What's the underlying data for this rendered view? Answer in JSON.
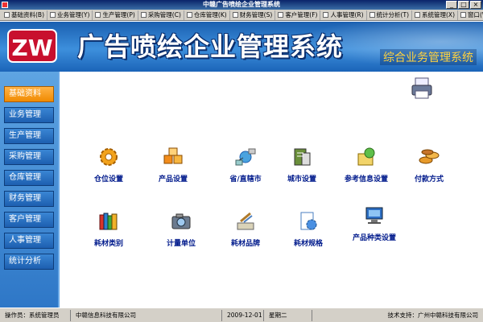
{
  "window": {
    "title": "中赣广告喷绘企业管理系统",
    "controls": [
      "_",
      "□",
      "×"
    ]
  },
  "menu": [
    {
      "label": "基础资料(B)"
    },
    {
      "label": "业务管理(Y)"
    },
    {
      "label": "生产管理(P)"
    },
    {
      "label": "采购管理(C)"
    },
    {
      "label": "仓库管理(K)"
    },
    {
      "label": "财务管理(S)"
    },
    {
      "label": "客户管理(F)"
    },
    {
      "label": "人事管理(R)"
    },
    {
      "label": "统计分析(T)"
    },
    {
      "label": "系统管理(X)"
    },
    {
      "label": "窗口(W)"
    }
  ],
  "banner": {
    "logo_text": "ZW",
    "title": "广告喷绘企业管理系统",
    "subtitle": "综合业务管理系统"
  },
  "sidebar": {
    "items": [
      {
        "label": "基础资料",
        "active": true
      },
      {
        "label": "业务管理"
      },
      {
        "label": "生产管理"
      },
      {
        "label": "采购管理"
      },
      {
        "label": "仓库管理"
      },
      {
        "label": "财务管理"
      },
      {
        "label": "客户管理"
      },
      {
        "label": "人事管理"
      },
      {
        "label": "统计分析"
      }
    ]
  },
  "tiles": [
    {
      "label": "仓位设置",
      "icon": "gear-icon"
    },
    {
      "label": "产品设置",
      "icon": "boxes-icon"
    },
    {
      "label": "省/直辖市",
      "icon": "network-icon"
    },
    {
      "label": "城市设置",
      "icon": "city-icon"
    },
    {
      "label": "参考信息设置",
      "icon": "info-icon"
    },
    {
      "label": "付款方式",
      "icon": "coins-icon"
    },
    {
      "label": "耗材类别",
      "icon": "books-icon"
    },
    {
      "label": "计量单位",
      "icon": "camera-icon"
    },
    {
      "label": "耗材品牌",
      "icon": "tools-icon"
    },
    {
      "label": "耗材规格",
      "icon": "doc-gear-icon"
    },
    {
      "label": "产品种类设置",
      "icon": "monitor-icon"
    }
  ],
  "status": {
    "operator": "操作员：系统管理员",
    "company": "中赣信息科技有限公司",
    "date": "2009-12-01",
    "weekday": "星期二",
    "support": "技术支持：广州中赣科技有限公司"
  },
  "colors": {
    "banner": "#2f7fd0",
    "sidebar": "#3a86d4",
    "active": "#f08a00",
    "tile_label": "#001a8c"
  }
}
